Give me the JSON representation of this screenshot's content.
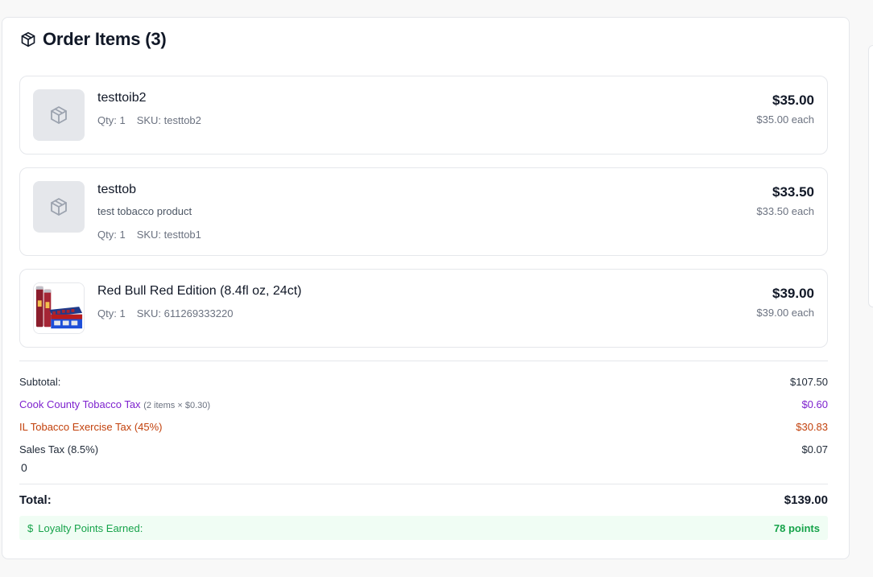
{
  "header": {
    "title": "Order Items (3)",
    "icon": "package-icon"
  },
  "items": [
    {
      "name": "testtoib2",
      "description": "",
      "qty": "Qty: 1",
      "sku": "SKU: testtob2",
      "price": "$35.00",
      "each": "$35.00 each",
      "image": "placeholder"
    },
    {
      "name": "testtob",
      "description": "test tobacco product",
      "qty": "Qty: 1",
      "sku": "SKU: testtob1",
      "price": "$33.50",
      "each": "$33.50 each",
      "image": "placeholder"
    },
    {
      "name": "Red Bull Red Edition (8.4fl oz, 24ct)",
      "description": "",
      "qty": "Qty: 1",
      "sku": "SKU: 611269333220",
      "price": "$39.00",
      "each": "$39.00 each",
      "image": "product-photo"
    }
  ],
  "summary": {
    "subtotal_label": "Subtotal:",
    "subtotal_value": "$107.50",
    "cook_tax_label": "Cook County Tobacco Tax",
    "cook_tax_detail": "(2 items × $0.30)",
    "cook_tax_value": "$0.60",
    "il_tax_label": "IL Tobacco Exercise Tax (45%)",
    "il_tax_value": "$30.83",
    "sales_tax_label": "Sales Tax (8.5%)",
    "sales_tax_value": "$0.07",
    "stray_text": "0",
    "total_label": "Total:",
    "total_value": "$139.00"
  },
  "loyalty": {
    "label": "Loyalty Points Earned:",
    "value": "78 points",
    "icon": "dollar-icon"
  },
  "colors": {
    "purple": "#7e22ce",
    "orange": "#c2410c",
    "green": "#16a34a",
    "green_bg": "#f0fdf4"
  }
}
